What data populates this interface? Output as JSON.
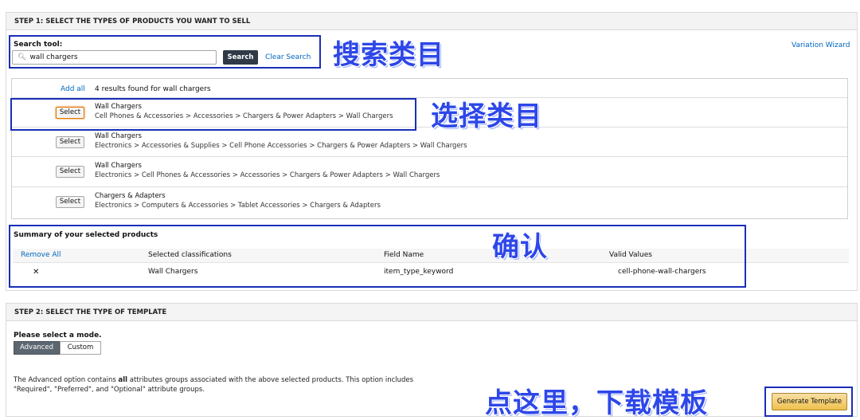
{
  "step1": {
    "header": "STEP 1: SELECT THE TYPES OF PRODUCTS YOU WANT TO SELL",
    "search_label": "Search tool:",
    "search_value": "wall chargers",
    "search_button": "Search",
    "clear_search": "Clear Search",
    "variation_wizard": "Variation Wizard",
    "add_all": "Add all",
    "results_count": "4 results found for wall chargers",
    "select_label": "Select",
    "results": [
      {
        "title": "Wall Chargers",
        "path": "Cell Phones & Accessories > Accessories > Chargers & Power Adapters > Wall Chargers"
      },
      {
        "title": "Wall Chargers",
        "path": "Electronics > Accessories & Supplies > Cell Phone Accessories > Chargers & Power Adapters > Wall Chargers"
      },
      {
        "title": "Wall Chargers",
        "path": "Electronics > Cell Phones & Accessories > Accessories > Chargers & Power Adapters > Wall Chargers"
      },
      {
        "title": "Chargers & Adapters",
        "path": "Electronics > Computers & Accessories > Tablet Accessories > Chargers & Adapters"
      }
    ]
  },
  "summary": {
    "title": "Summary of your selected products",
    "remove_all": "Remove All",
    "col_classifications": "Selected classifications",
    "col_field": "Field Name",
    "col_values": "Valid Values",
    "row": {
      "remove": "✕",
      "classification": "Wall Chargers",
      "field": "item_type_keyword",
      "value": "cell-phone-wall-chargers"
    }
  },
  "step2": {
    "header": "STEP 2: SELECT THE TYPE OF TEMPLATE",
    "mode_label": "Please select a mode.",
    "mode_advanced": "Advanced",
    "mode_custom": "Custom",
    "desc_pre": "The Advanced option contains ",
    "desc_bold": "all",
    "desc_post": " attributes groups associated with the above selected products. This option includes",
    "desc_line2": "\"Required\", \"Preferred\", and \"Optional\" attribute groups.",
    "generate_button": "Generate Template"
  },
  "annotations": {
    "search_category": "搜索类目",
    "select_category": "选择类目",
    "confirm": "确认",
    "click_here": "点这里，下载模板"
  },
  "colors": {
    "annotation_box": "#1a2fb5",
    "annotation_text": "#2d47e8",
    "link": "#0066c0",
    "primary_button": "#f0c14b"
  }
}
